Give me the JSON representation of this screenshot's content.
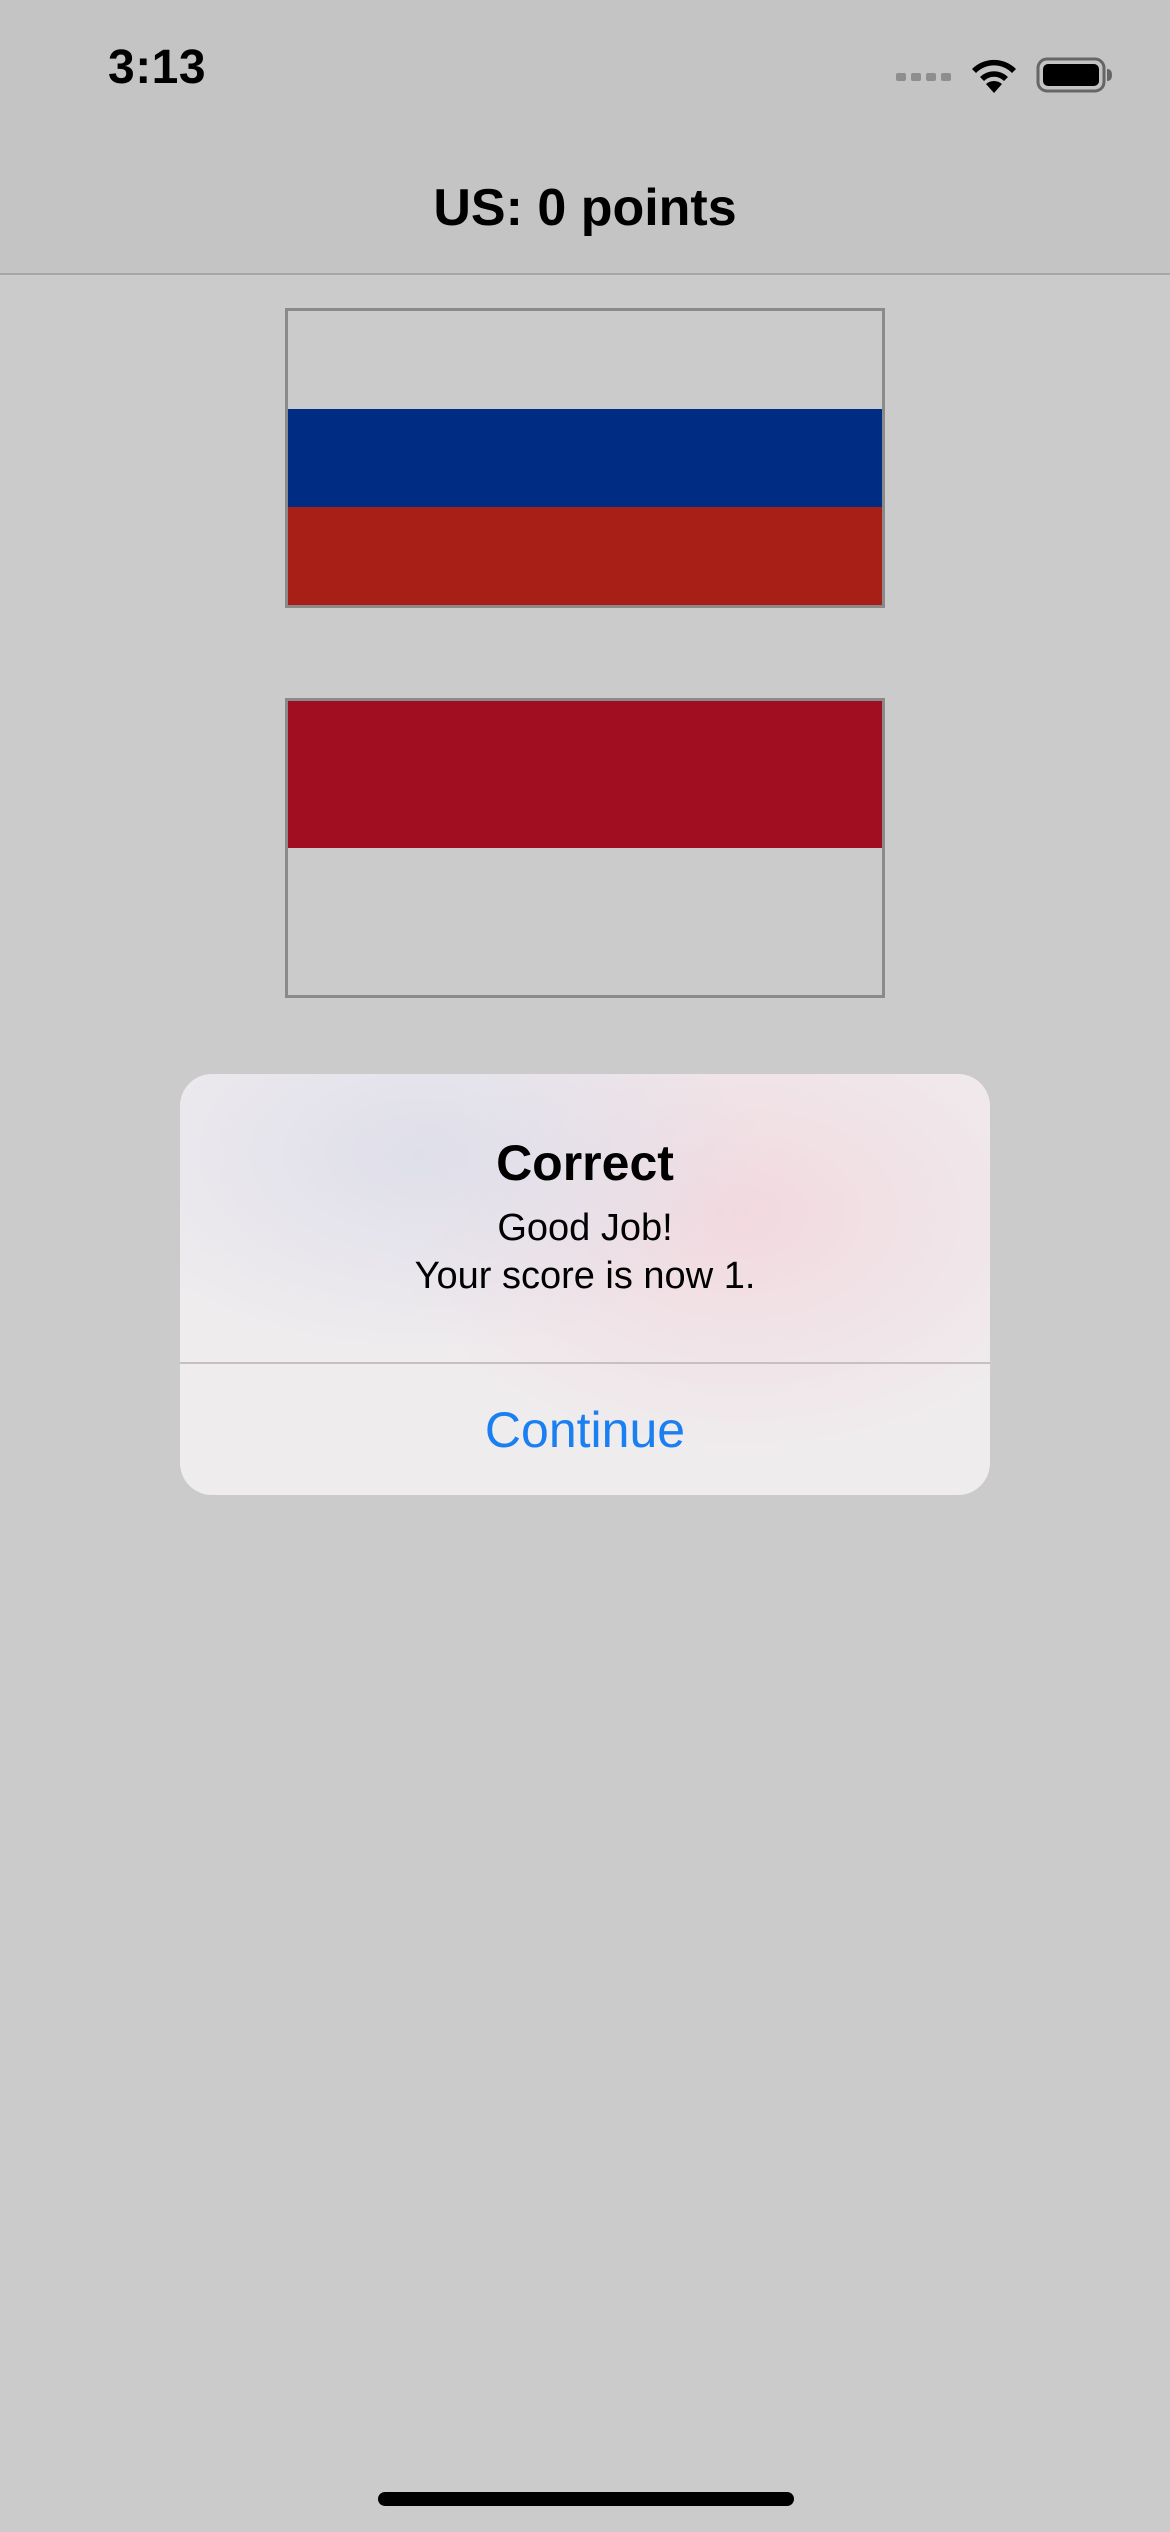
{
  "status_bar": {
    "time": "3:13",
    "icons": [
      "signal-icon",
      "wifi-icon",
      "battery-icon"
    ]
  },
  "nav": {
    "title": "US: 0 points"
  },
  "flags": [
    {
      "name": "flag-russia",
      "stripes": [
        "#cbcbcb",
        "#002c83",
        "#a81f18"
      ]
    },
    {
      "name": "flag-indonesia",
      "stripes": [
        "#a20e21",
        "#cbcbcb"
      ]
    }
  ],
  "alert": {
    "title": "Correct",
    "message_line1": "Good Job!",
    "message_line2": "Your score is now 1.",
    "button_label": "Continue"
  },
  "colors": {
    "accent": "#1a7ff0",
    "background": "#cbcbcb"
  }
}
